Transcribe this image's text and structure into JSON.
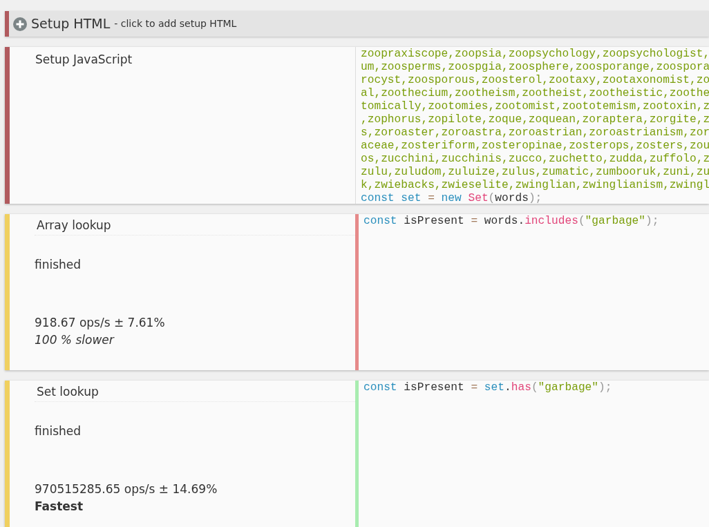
{
  "setup_html": {
    "title": "Setup HTML",
    "hint": "- click to add setup HTML"
  },
  "setup_js": {
    "title": "Setup JavaScript",
    "code": [
      [
        {
          "kind": "string",
          "text": "zoopraxiscope,zoopsia,zoopsychology,zoopsychologist,"
        }
      ],
      [
        {
          "kind": "string",
          "text": "um,zoosperms,zoospgia,zoosphere,zoosporange,zoospora"
        }
      ],
      [
        {
          "kind": "string",
          "text": "rocyst,zoosporous,zoosterol,zootaxy,zootaxonomist,zo"
        }
      ],
      [
        {
          "kind": "string",
          "text": "al,zoothecium,zootheism,zootheist,zootheistic,zoothe"
        }
      ],
      [
        {
          "kind": "string",
          "text": "tomically,zootomies,zootomist,zoototemism,zootoxin,z"
        }
      ],
      [
        {
          "kind": "string",
          "text": ",zophorus,zopilote,zoque,zoquean,zoraptera,zorgite,z"
        }
      ],
      [
        {
          "kind": "string",
          "text": "s,zoroaster,zoroastra,zoroastrian,zoroastrianism,zor"
        }
      ],
      [
        {
          "kind": "string",
          "text": "aceae,zosteriform,zosteropinae,zosterops,zosters,zou"
        }
      ],
      [
        {
          "kind": "string",
          "text": "os,zucchini,zucchinis,zucco,zuchetto,zudda,zuffolo,z"
        }
      ],
      [
        {
          "kind": "string",
          "text": "zulu,zuludom,zuluize,zulus,zumatic,zumbooruk,zuni,zu"
        }
      ],
      [
        {
          "kind": "string",
          "text": "k,zwiebacks,zwieselite,zwinglian,zwinglianism,zwingl"
        }
      ],
      [
        {
          "kind": "keyword",
          "text": "const"
        },
        {
          "kind": "def",
          "text": " set"
        },
        {
          "kind": "operator",
          "text": " ="
        },
        {
          "kind": "keyword",
          "text": " new"
        },
        {
          "kind": "func",
          "text": " Set"
        },
        {
          "kind": "punct",
          "text": "("
        },
        {
          "kind": "plain",
          "text": "words"
        },
        {
          "kind": "punct",
          "text": ");"
        }
      ]
    ]
  },
  "tests": [
    {
      "title": "Array lookup",
      "status": "finished",
      "result": "918.67 ops/s ± 7.61%",
      "kind": "slower",
      "comparison": "100 % slower",
      "code": [
        [
          {
            "kind": "keyword",
            "text": "const"
          },
          {
            "kind": "plain",
            "text": " isPresent "
          },
          {
            "kind": "operator",
            "text": "="
          },
          {
            "kind": "plain",
            "text": " words."
          },
          {
            "kind": "func",
            "text": "includes"
          },
          {
            "kind": "punct",
            "text": "("
          },
          {
            "kind": "string",
            "text": "\"garbage\""
          },
          {
            "kind": "punct",
            "text": ");"
          }
        ]
      ]
    },
    {
      "title": "Set lookup",
      "status": "finished",
      "result": "970515285.65 ops/s ± 14.69%",
      "kind": "fastest",
      "comparison": "Fastest",
      "code": [
        [
          {
            "kind": "keyword",
            "text": "const"
          },
          {
            "kind": "plain",
            "text": " isPresent "
          },
          {
            "kind": "operator",
            "text": "="
          },
          {
            "kind": "def",
            "text": " set"
          },
          {
            "kind": "plain",
            "text": "."
          },
          {
            "kind": "func",
            "text": "has"
          },
          {
            "kind": "punct",
            "text": "("
          },
          {
            "kind": "string",
            "text": "\"garbage\""
          },
          {
            "kind": "punct",
            "text": ");"
          }
        ]
      ]
    }
  ]
}
